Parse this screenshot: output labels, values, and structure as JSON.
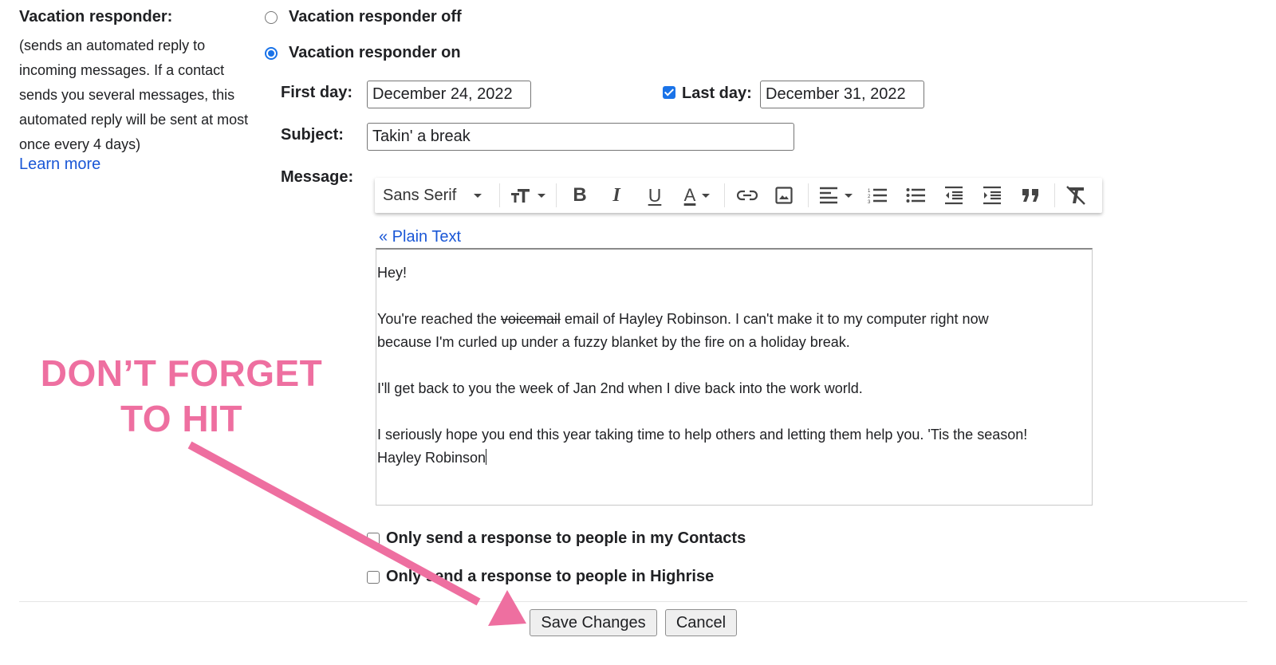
{
  "section": {
    "title": "Vacation responder:",
    "description": "(sends an automated reply to incoming messages. If a contact sends you several messages, this automated reply will be sent at most once every 4 days)",
    "learn_more": "Learn more"
  },
  "responder": {
    "off_label": "Vacation responder off",
    "on_label": "Vacation responder on",
    "selected": "on"
  },
  "dates": {
    "first_day_label": "First day:",
    "first_day_value": "December 24, 2022",
    "last_day_label": "Last day:",
    "last_day_checked": true,
    "last_day_value": "December 31, 2022"
  },
  "subject": {
    "label": "Subject:",
    "value": "Takin' a break"
  },
  "message": {
    "label": "Message:",
    "plain_text_link": "« Plain Text",
    "toolbar": {
      "font": "Sans Serif",
      "icons": [
        "font-size-icon",
        "bold-icon",
        "italic-icon",
        "underline-icon",
        "text-color-icon",
        "link-icon",
        "image-icon",
        "align-icon",
        "numbered-list-icon",
        "bulleted-list-icon",
        "indent-less-icon",
        "indent-more-icon",
        "quote-icon",
        "remove-formatting-icon"
      ]
    },
    "body": {
      "line1": "Hey!",
      "line2_before": "You're reached the ",
      "line2_strike": "voicemail",
      "line2_after": " email of Hayley Robinson. I can't make it to my computer right now",
      "line3": "because I'm curled up under a fuzzy blanket by the fire on a holiday break.",
      "line4": "I'll get back to you the week of Jan 2nd when I dive back into the work world.",
      "line5": "I seriously hope you end this year taking time to help others and letting them help you. 'Tis the season!",
      "line6": "Hayley Robinson"
    }
  },
  "options": {
    "contacts_only": {
      "label": "Only send a response to people in my Contacts",
      "checked": false
    },
    "highrise_only": {
      "label": "Only send a response to people in Highrise",
      "checked": false
    }
  },
  "buttons": {
    "save": "Save Changes",
    "cancel": "Cancel"
  },
  "annotation": {
    "line1": "DON’T FORGET",
    "line2": "TO HIT",
    "color": "#ee6fa0"
  },
  "colors": {
    "accent": "#1a73e8",
    "link": "#1a57d6"
  }
}
